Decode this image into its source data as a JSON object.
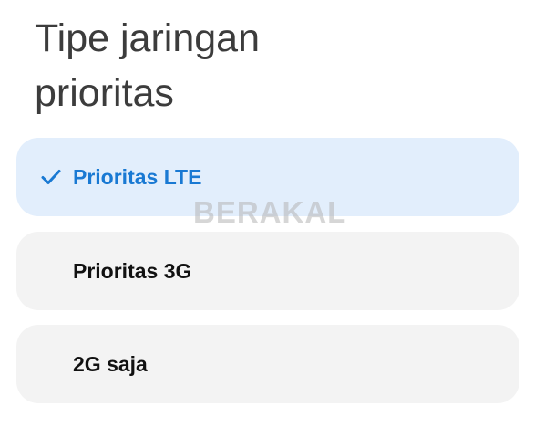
{
  "dialog": {
    "title": "Tipe jaringan prioritas"
  },
  "options": [
    {
      "label": "Prioritas LTE",
      "selected": true,
      "icon": "checkmark-icon"
    },
    {
      "label": "Prioritas 3G",
      "selected": false
    },
    {
      "label": "2G saja",
      "selected": false
    }
  ],
  "colors": {
    "accent": "#1979d3",
    "selected_background": "#e2eefc",
    "option_background": "#f3f3f3"
  },
  "watermark": {
    "text": "BERAKAL"
  }
}
